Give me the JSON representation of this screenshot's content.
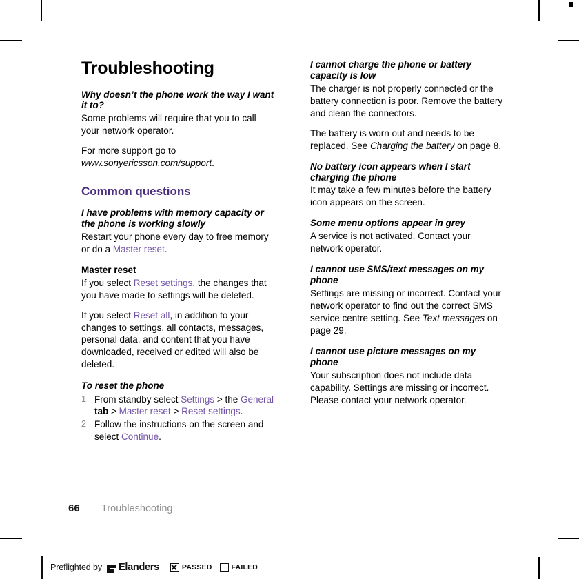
{
  "document": {
    "title": "Troubleshooting",
    "page_number": "66",
    "footer_chapter": "Troubleshooting"
  },
  "left_column": {
    "intro_question": "Why doesn’t the phone work the way I want it to?",
    "intro_answer": "Some problems will require that you to call your network operator.",
    "support_line_1": "For more support go to ",
    "support_url": "www.sonyericsson.com/support",
    "support_line_end": ".",
    "section_heading": "Common questions",
    "memory_question": "I have problems with memory capacity or the phone is working slowly",
    "memory_answer_1": "Restart your phone every day to free memory or do a ",
    "memory_answer_link": "Master reset",
    "memory_answer_end": ".",
    "master_reset_heading": "Master reset",
    "reset_settings_pre": "If you select ",
    "reset_settings_link": "Reset settings",
    "reset_settings_post": ", the changes that you have made to settings will be deleted.",
    "reset_all_pre": "If you select ",
    "reset_all_link": "Reset all",
    "reset_all_post": ", in addition to your changes to settings, all contacts, messages, personal data, and content that you have downloaded, received or edited will also be deleted.",
    "procedure_title": "To reset the phone",
    "steps": [
      {
        "number": "1",
        "part_1": "From standby select ",
        "link_1": "Settings",
        "part_2": " > the ",
        "link_2": "General",
        "bold_1": " tab ",
        "part_3": "> ",
        "link_3": "Master reset",
        "part_4": " > ",
        "link_4": "Reset settings",
        "part_5": "."
      },
      {
        "number": "2",
        "part_1": "Follow the instructions on the screen and select ",
        "link_1": "Continue",
        "part_2": "."
      }
    ]
  },
  "right_column": {
    "charge_question": "I cannot charge the phone or battery capacity is low",
    "charge_answer": "The charger is not properly connected or the battery connection is poor. Remove the battery and clean the connectors.",
    "battery_worn_pre": "The battery is worn out and needs to be replaced. See ",
    "battery_worn_xref": "Charging the battery",
    "battery_worn_post": " on page 8.",
    "no_icon_question": "No battery icon appears when I start charging the phone",
    "no_icon_answer": "It may take a few minutes before the battery icon appears on the screen.",
    "grey_question": "Some menu options appear in grey",
    "grey_answer": "A service is not activated. Contact your network operator.",
    "sms_question": "I cannot use SMS/text messages on my phone",
    "sms_answer_pre": "Settings are missing or incorrect. Contact your network operator to find out the correct SMS service centre setting. See ",
    "sms_answer_xref": "Text messages",
    "sms_answer_post": " on page 29.",
    "picture_question": "I cannot use picture messages on my phone",
    "picture_answer": "Your subscription does not include data capability. Settings are missing or incorrect. Please contact your network operator."
  },
  "preflight": {
    "prefix": "Preflighted by",
    "brand": "Elanders",
    "passed_label": "PASSED",
    "failed_label": "FAILED"
  },
  "colors": {
    "link": "#7254a5",
    "section_heading": "#4b2d7f",
    "footer_chapter": "#8f8f8f",
    "step_number": "#8c8c8c"
  }
}
